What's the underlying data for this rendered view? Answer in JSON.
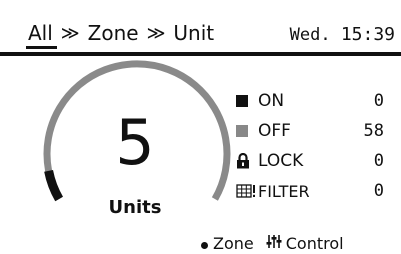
{
  "header": {
    "breadcrumb": [
      "All",
      "Zone",
      "Unit"
    ],
    "separator": "≫",
    "day": "Wed.",
    "time": "15:39"
  },
  "summary": {
    "count": "5",
    "unit_label": "Units",
    "gauge_fraction": 0.08
  },
  "status": [
    {
      "label": "ON",
      "value": "0",
      "icon": "square-filled-icon",
      "color": "#111111"
    },
    {
      "label": "OFF",
      "value": "58",
      "icon": "square-gray-icon",
      "color": "#888888"
    },
    {
      "label": "LOCK",
      "value": "0",
      "icon": "lock-icon",
      "color": "#111111"
    },
    {
      "label": "FILTER",
      "value": "0",
      "icon": "filter-alert-icon",
      "color": "#111111"
    }
  ],
  "footer": {
    "zone_label": "Zone",
    "control_label": "Control"
  },
  "colors": {
    "gauge_track": "#8a8a8a",
    "gauge_fill": "#111111",
    "text": "#111111"
  }
}
